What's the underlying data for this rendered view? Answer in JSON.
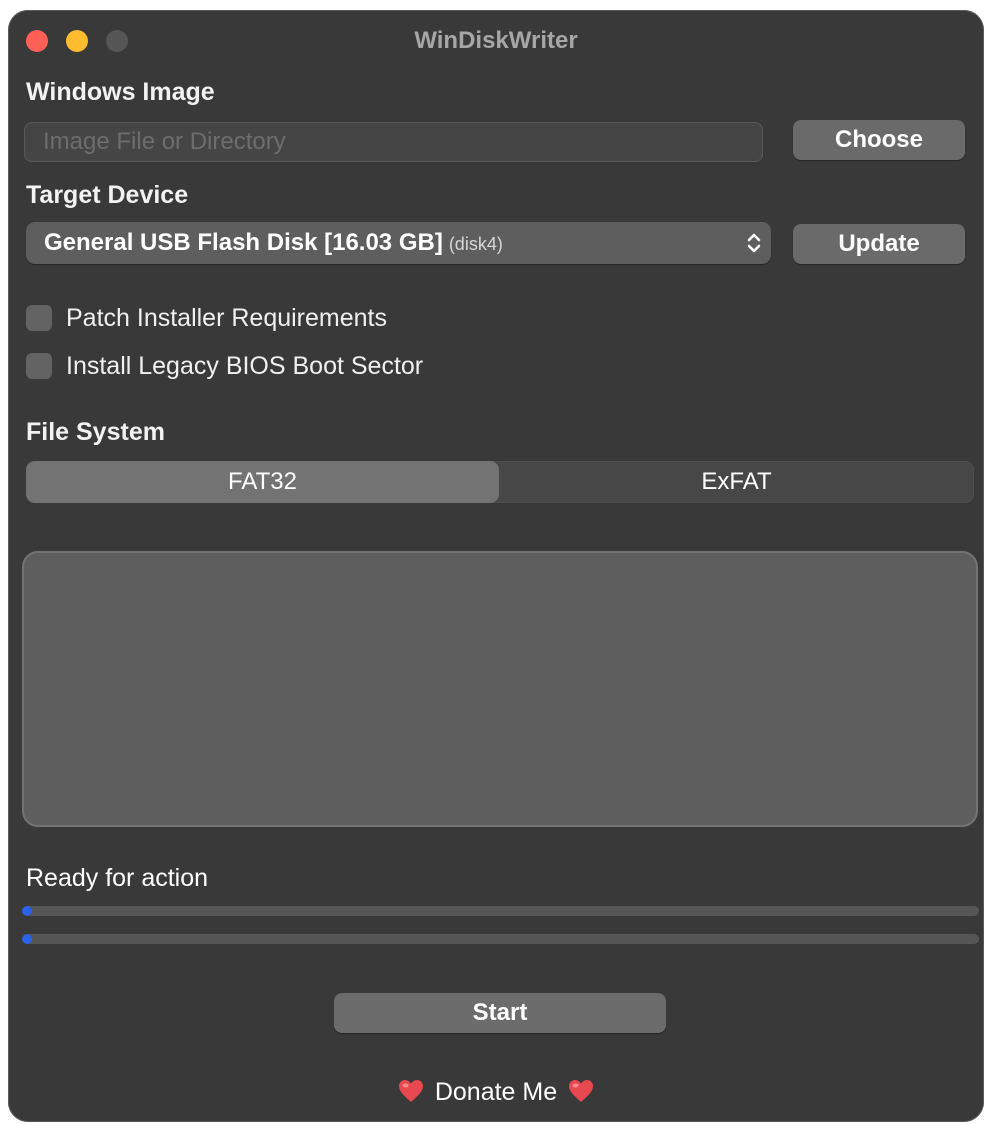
{
  "window": {
    "title": "WinDiskWriter",
    "controls": [
      "close",
      "minimize",
      "zoom-disabled"
    ]
  },
  "windows_image": {
    "label": "Windows Image",
    "input_value": "",
    "input_placeholder": "Image File or Directory",
    "choose_label": "Choose"
  },
  "target_device": {
    "label": "Target Device",
    "selected_device": "General USB Flash Disk [16.03 GB]",
    "selected_device_id": "(disk4)",
    "update_label": "Update"
  },
  "options": {
    "patch_installer": {
      "label": "Patch Installer Requirements",
      "checked": false
    },
    "legacy_bios": {
      "label": "Install Legacy BIOS Boot Sector",
      "checked": false
    }
  },
  "file_system": {
    "label": "File System",
    "options": [
      "FAT32",
      "ExFAT"
    ],
    "selected": "FAT32"
  },
  "log": {
    "content": ""
  },
  "status": {
    "text": "Ready for action",
    "progress_primary": 0,
    "progress_secondary": 0
  },
  "actions": {
    "start_label": "Start",
    "donate_label": "Donate Me"
  },
  "colors": {
    "window_bg": "#393939",
    "close": "#fe5f57",
    "minimize": "#febc2e",
    "accent": "#2a62e8",
    "heart": "#e8484f"
  },
  "icons": [
    "chevron-up-down-icon",
    "heart-icon"
  ]
}
